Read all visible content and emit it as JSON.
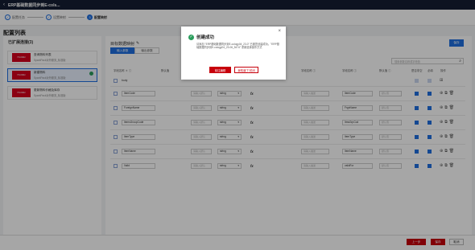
{
  "topbar": {
    "back": "‹",
    "title": "ERP基础数据同步到E-cols..."
  },
  "steps": [
    {
      "num": "✓",
      "label": "配置任务"
    },
    {
      "num": "✓",
      "label": "设置映射"
    },
    {
      "num": "3",
      "label": "配置映射"
    }
  ],
  "page_title": "配置列表",
  "left": {
    "header": "已扩展连接(3)",
    "cards": [
      {
        "logo": "HUAWEI",
        "name": "查询物料列表",
        "type": "SparkPack对外服务_标准版"
      },
      {
        "logo": "HUAWEI",
        "name": "新建物料",
        "type": "SparkPack对外服务_标准版"
      },
      {
        "logo": "HUAWEI",
        "name": "更新物料价格及库存",
        "type": "SparkPack对外服务_标准版"
      }
    ]
  },
  "main": {
    "header": "目标数据映射",
    "edit_icon": "✎",
    "tabs": [
      "输入参数",
      "输出参数"
    ],
    "top_button": "保存",
    "search_placeholder": "搜索参数名称或字段值",
    "columns": [
      "字段名称 ＊ ⓘ",
      "默认值",
      "字段类型",
      "",
      "",
      "字段名称 ⓘ",
      "字段名称 ⓘ",
      "默认值 ⓘ",
      "是否非空",
      "必填",
      "操作"
    ],
    "root_row": "body",
    "rows": [
      {
        "field": "ItemCode",
        "type": "string",
        "mapped": "ItemCode"
      },
      {
        "field": "ForeignName",
        "type": "string",
        "mapped": "FrgnName"
      },
      {
        "field": "ItemsGroupCode",
        "type": "string",
        "mapped": "ItmsGrpCod"
      },
      {
        "field": "ItemType",
        "type": "string",
        "mapped": "ItemType"
      },
      {
        "field": "ItemName",
        "type": "string",
        "mapped": "ItemName"
      },
      {
        "field": "Valid",
        "type": "string",
        "mapped": "validFor"
      }
    ],
    "placeholder_default": "请输入默认",
    "placeholder_desc": "请输入描述",
    "placeholder_val": "默认值",
    "fx": "fx",
    "dropdown_icon": "▾",
    "ops": [
      "⊕",
      "⧉",
      "🗑"
    ]
  },
  "footer": {
    "prev": "上一步",
    "save": "保存",
    "cancel": "取消"
  },
  "dialog": {
    "title": "创建成功",
    "close": "×",
    "message": "请添加 \"ERP基础数据同步到E-cology04_23-0\" 已被您创建成功。\"ERP基础数据同步到E-cology04_23-06_5474\" 重新选择操作方式",
    "btn_primary": "前往编辑",
    "btn_secondary": "我知道了/关闭"
  }
}
